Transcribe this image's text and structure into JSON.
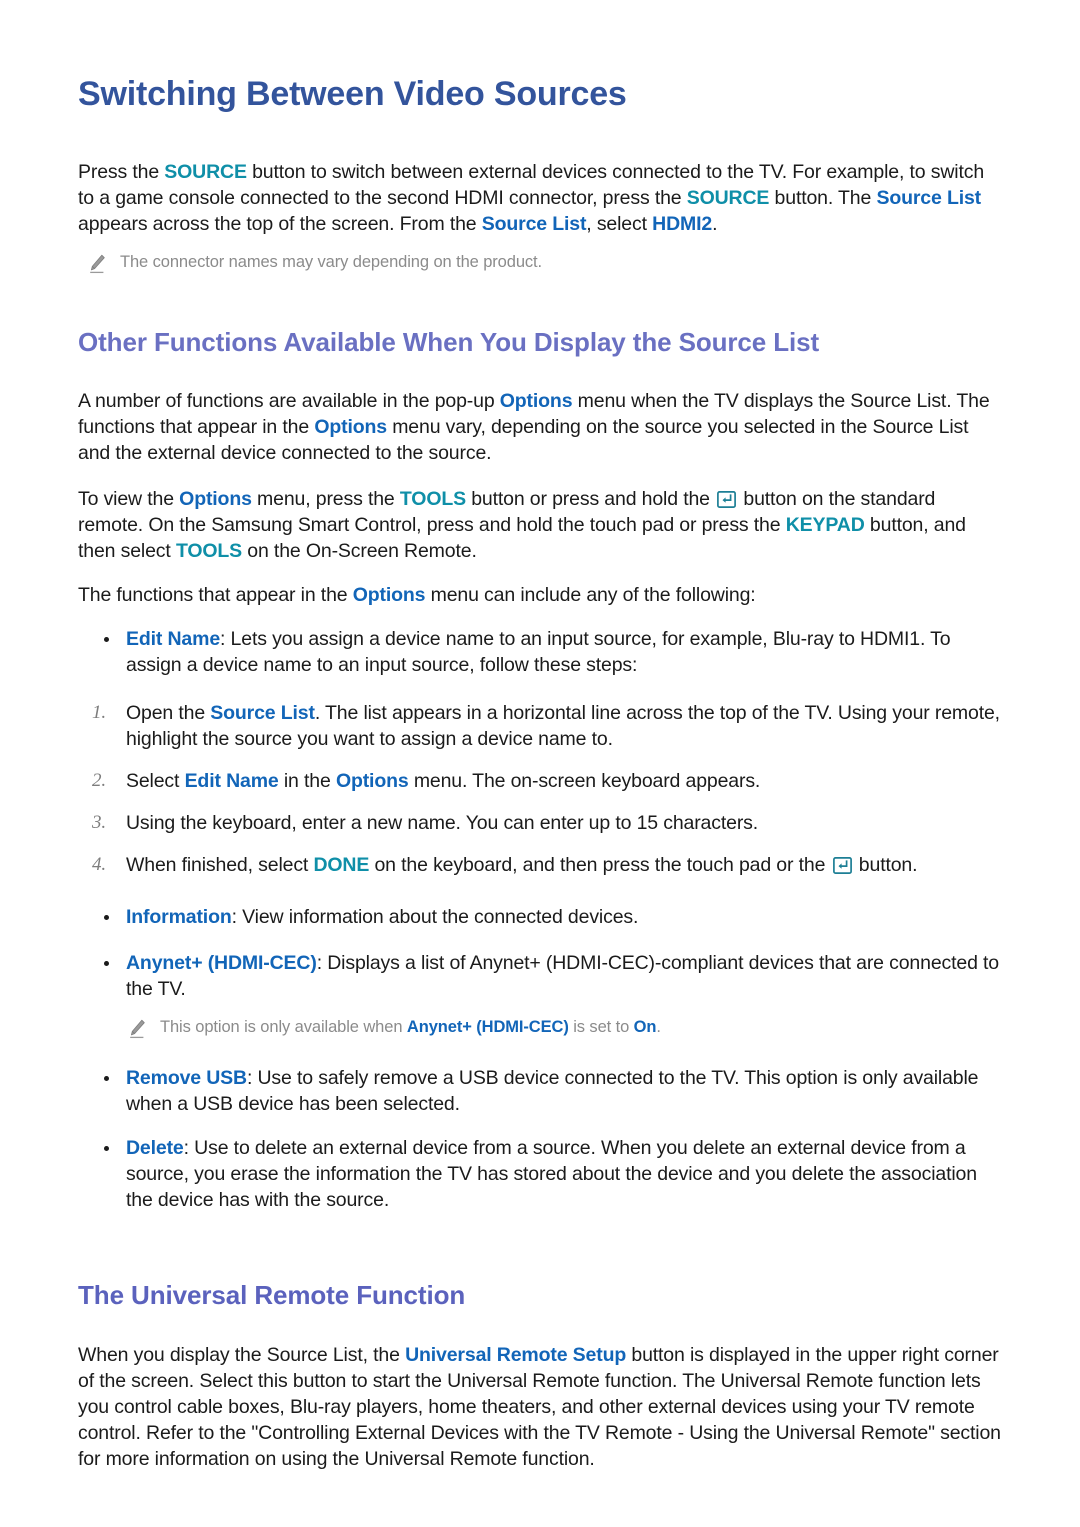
{
  "colors": {
    "title_blue": "#33549c",
    "heading_violet": "#6a70c2",
    "accent_teal": "#0f8fa8",
    "accent_blue": "#1265b8",
    "body_text": "#1b1b1b",
    "note_gray": "#8b8b8b",
    "step_number_gray": "#7d7d7d"
  },
  "doc": {
    "title": "Switching Between Video Sources",
    "intro": {
      "p1_a": "Press the ",
      "p1_k1": "SOURCE",
      "p1_b": " button to switch between external devices connected to the TV. For example, to switch to a game console connected to the second HDMI connector, press the ",
      "p1_k2": "SOURCE",
      "p1_c": " button. The ",
      "p1_k3": "Source List",
      "p1_d": " appears across the top of the screen. From the ",
      "p1_k4": "Source List",
      "p1_e": ", select ",
      "p1_k5": "HDMI2",
      "p1_f": "."
    },
    "note1": "The connector names may vary depending on the product.",
    "section2": {
      "heading": "Other Functions Available When You Display the Source List",
      "p1_a": "A number of functions are available in the pop-up ",
      "p1_k1": "Options",
      "p1_b": " menu when the TV displays the Source List. The functions that appear in the ",
      "p1_k2": "Options",
      "p1_c": " menu vary, depending on the source you selected in the Source List and the external device connected to the source.",
      "p2_a": "To view the ",
      "p2_k1": "Options",
      "p2_b": " menu, press the ",
      "p2_k2": "TOOLS",
      "p2_c": " button or press and hold the ",
      "p2_icon": "enter-key-icon",
      "p2_d": " button on the standard remote. On the Samsung Smart Control, press and hold the touch pad or press the ",
      "p2_k3": "KEYPAD",
      "p2_e": " button, and then select ",
      "p2_k4": "TOOLS",
      "p2_f": " on the On-Screen Remote.",
      "p3_a": "The functions that appear in the ",
      "p3_k1": "Options",
      "p3_b": " menu can include any of the following:"
    },
    "bullet_edit_name": {
      "label": "Edit Name",
      "text": ": Lets you assign a device name to an input source, for example, Blu-ray to HDMI1. To assign a device name to an input source, follow these steps:"
    },
    "steps": [
      {
        "num": "1.",
        "a": "Open the ",
        "k": "Source List",
        "b": ". The list appears in a horizontal line across the top of the TV. Using your remote, highlight the source you want to assign a device name to."
      },
      {
        "num": "2.",
        "a": "Select ",
        "k": "Edit Name",
        "b": " in the ",
        "k2": "Options",
        "c": " menu. The on-screen keyboard appears."
      },
      {
        "num": "3.",
        "a": "Using the keyboard, enter a new name. You can enter up to 15 characters."
      },
      {
        "num": "4.",
        "a": "When finished, select ",
        "k": "DONE",
        "b": " on the keyboard, and then press the touch pad or the ",
        "icon": "enter-key-icon",
        "c": " button."
      }
    ],
    "bullet_information": {
      "label": "Information",
      "text": ": View information about the connected devices."
    },
    "bullet_anynet": {
      "label": "Anynet+ (HDMI-CEC)",
      "text": ": Displays a list of Anynet+ (HDMI-CEC)-compliant devices that are connected to the TV."
    },
    "note2": {
      "a": "This option is only available when ",
      "k1": "Anynet+ (HDMI-CEC)",
      "b": " is set to ",
      "k2": "On",
      "c": "."
    },
    "bullet_remove_usb": {
      "label": "Remove USB",
      "text": ": Use to safely remove a USB device connected to the TV. This option is only available when a USB device has been selected."
    },
    "bullet_delete": {
      "label": "Delete",
      "text": ": Use to delete an external device from a source. When you delete an external device from a source, you erase the information the TV has stored about the device and you delete the association the device has with the source."
    },
    "section3": {
      "heading": "The Universal Remote Function",
      "p1_a": "When you display the Source List, the ",
      "p1_k1": "Universal Remote Setup",
      "p1_b": " button is displayed in the upper right corner of the screen. Select this button to start the Universal Remote function. The Universal Remote function lets you control cable boxes, Blu-ray players, home theaters, and other external devices using your TV remote control. Refer to the \"Controlling External Devices with the TV Remote - Using the Universal Remote\" section for more information on using the Universal Remote function."
    }
  }
}
